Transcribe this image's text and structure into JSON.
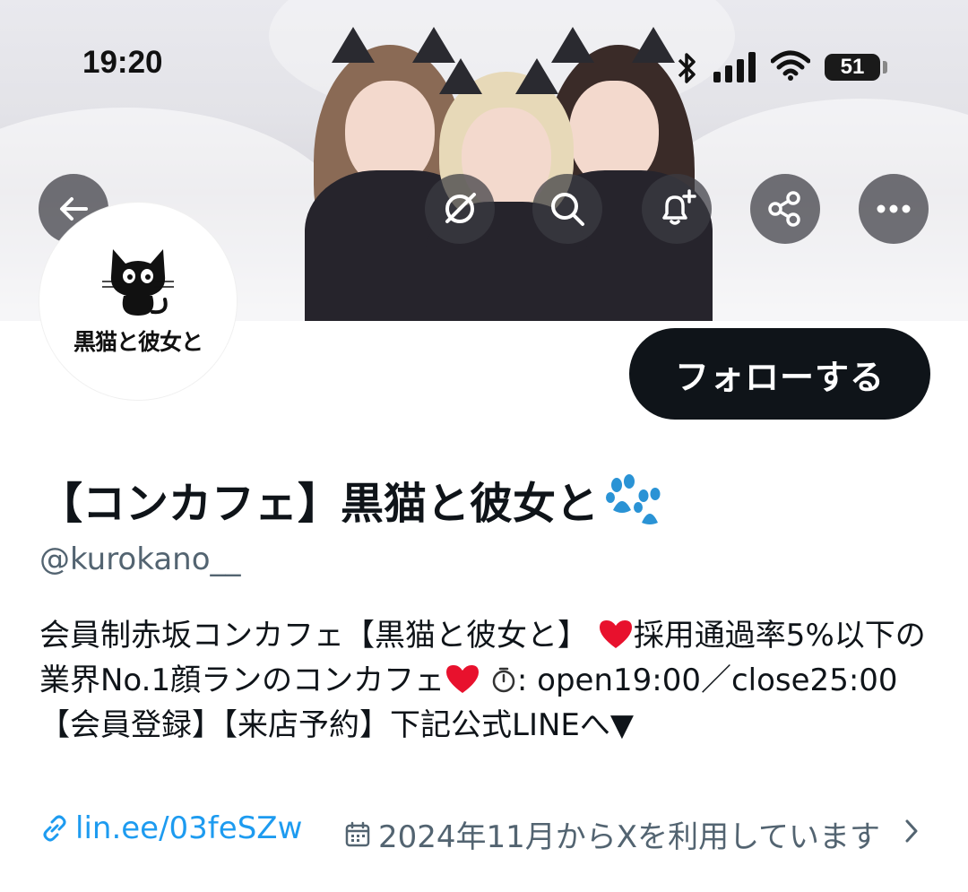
{
  "status_bar": {
    "time": "19:20",
    "battery": "51"
  },
  "header": {
    "back_icon": "arrow-left-icon",
    "grok_icon": "grok-icon",
    "search_icon": "search-icon",
    "notify_icon": "bell-plus-icon",
    "share_icon": "share-icon",
    "more_icon": "more-horizontal-icon"
  },
  "avatar": {
    "logo_text": "黒猫と彼女と"
  },
  "profile": {
    "follow_label": "フォローする",
    "display_name": "【コンカフェ】黒猫と彼女と",
    "handle": "@kurokano__",
    "bio": {
      "part1": "会員制赤坂コンカフェ【黒猫と彼女と】 ",
      "part2": "採用通過率5%以下の業界No.1顔ランのコンカフェ",
      "part3": ": open19:00／close25:00 【会員登録】【来店予約】下記公式LINEへ▼"
    },
    "link": "lin.ee/03feSZw",
    "joined": "2024年11月からXを利用しています"
  },
  "colors": {
    "accent": "#1d9bf0",
    "text": "#0f1419",
    "secondary": "#536471",
    "heart": "#e8112d"
  }
}
